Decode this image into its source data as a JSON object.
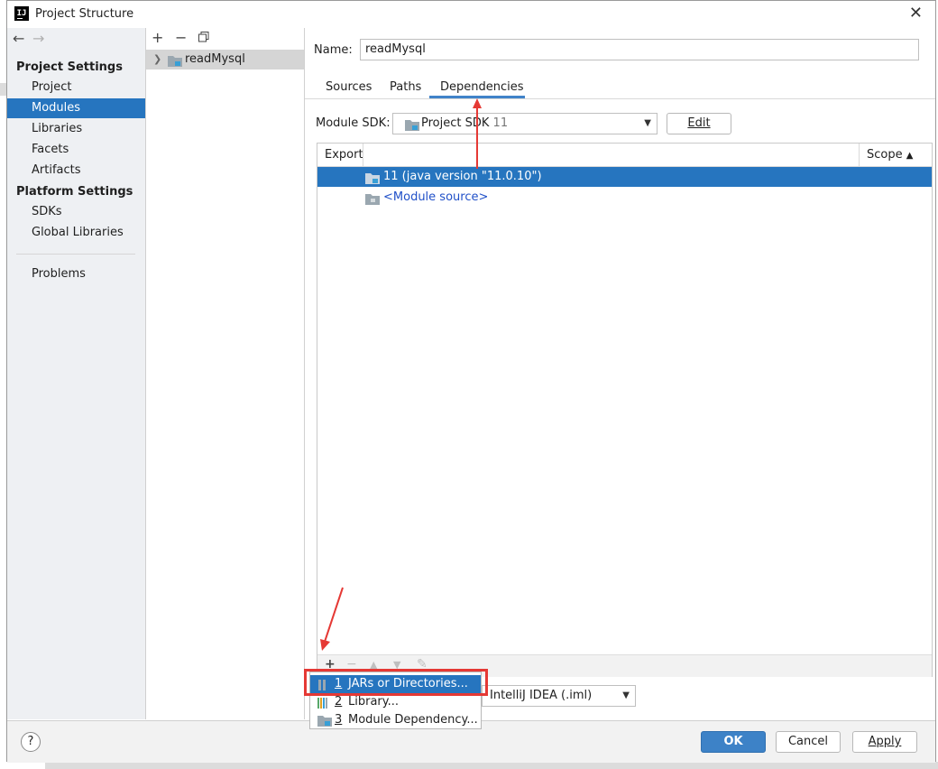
{
  "window": {
    "title": "Project Structure",
    "app_icon_text": "IJ"
  },
  "nav": {
    "back_icon": "back-arrow-icon",
    "forward_icon": "forward-arrow-icon",
    "project_settings_heading": "Project Settings",
    "project_settings": [
      "Project",
      "Modules",
      "Libraries",
      "Facets",
      "Artifacts"
    ],
    "platform_settings_heading": "Platform Settings",
    "platform_settings": [
      "SDKs",
      "Global Libraries"
    ],
    "problems": "Problems",
    "selected": "Modules"
  },
  "module_tree": {
    "toolbar_icons": [
      "add-icon",
      "remove-icon",
      "copy-icon"
    ],
    "modules": [
      "readMysql"
    ]
  },
  "module": {
    "name_label": "Name:",
    "name_value": "readMysql",
    "tabs": [
      "Sources",
      "Paths",
      "Dependencies"
    ],
    "active_tab": "Dependencies",
    "sdk_label": "Module SDK:",
    "sdk_value": "Project SDK",
    "sdk_version": "11",
    "edit_button": "Edit",
    "table": {
      "col_export": "Export",
      "col_scope": "Scope",
      "rows": [
        {
          "label": "11 (java version \"11.0.10\")",
          "selected": true
        },
        {
          "label": "<Module source>",
          "selected": false
        }
      ]
    },
    "format_value": "IntelliJ IDEA (.iml)"
  },
  "add_menu": {
    "items": [
      {
        "number": "1",
        "label": "JARs or Directories...",
        "selected": true
      },
      {
        "number": "2",
        "label": "Library...",
        "selected": false
      },
      {
        "number": "3",
        "label": "Module Dependency...",
        "selected": false
      }
    ]
  },
  "footer": {
    "help": "?",
    "ok": "OK",
    "cancel": "Cancel",
    "apply": "Apply"
  },
  "colors": {
    "selection": "#2675bf",
    "annotation": "#e53935",
    "link": "#2050c8"
  }
}
